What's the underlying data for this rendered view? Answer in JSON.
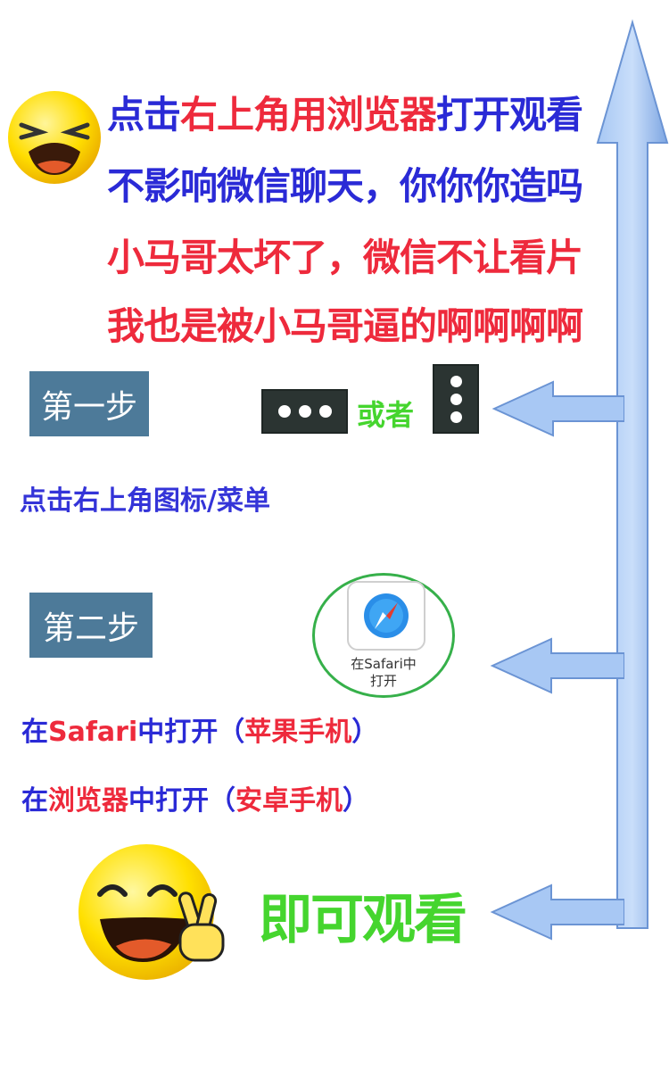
{
  "headline": {
    "line1": [
      {
        "text": "点击",
        "color": "blue"
      },
      {
        "text": "右上角用浏览器",
        "color": "red"
      },
      {
        "text": "打开观看",
        "color": "blue"
      }
    ],
    "line2": "不影响微信聊天，你你你造吗",
    "line3": "小马哥太坏了，微信不让看片",
    "line4": [
      {
        "text": "我也是被小马哥逼的",
        "color": "red"
      },
      {
        "text": "啊啊啊啊",
        "color": "red"
      }
    ]
  },
  "step1": {
    "label": "第一步",
    "or_text": "或者",
    "instruction": "点击右上角图标/菜单"
  },
  "step2": {
    "label": "第二步",
    "safari_label_line1": "在Safari中",
    "safari_label_line2": "打开",
    "instruction_ios": [
      {
        "text": "在",
        "color": "blue"
      },
      {
        "text": "Safari",
        "color": "red"
      },
      {
        "text": "中打开（",
        "color": "blue"
      },
      {
        "text": "苹果手机",
        "color": "red"
      },
      {
        "text": "）",
        "color": "blue"
      }
    ],
    "instruction_android": [
      {
        "text": "在",
        "color": "blue"
      },
      {
        "text": "浏览器",
        "color": "red"
      },
      {
        "text": "中打开（",
        "color": "blue"
      },
      {
        "text": "安卓手机",
        "color": "red"
      },
      {
        "text": "）",
        "color": "blue"
      }
    ]
  },
  "final": {
    "text": "即可观看"
  },
  "colors": {
    "blue_text": "#2a2ad6",
    "red_text": "#ee2a3c",
    "green_text": "#45d52e",
    "step_box": "#4d7a99",
    "arrow": "#8fb4ea",
    "emoji": "#ffdd00"
  },
  "icons": [
    "crying-emoji-icon",
    "more-horizontal-icon",
    "more-vertical-icon",
    "safari-compass-icon",
    "happy-peace-emoji-icon",
    "arrow-left-icon",
    "arrow-up-icon"
  ]
}
